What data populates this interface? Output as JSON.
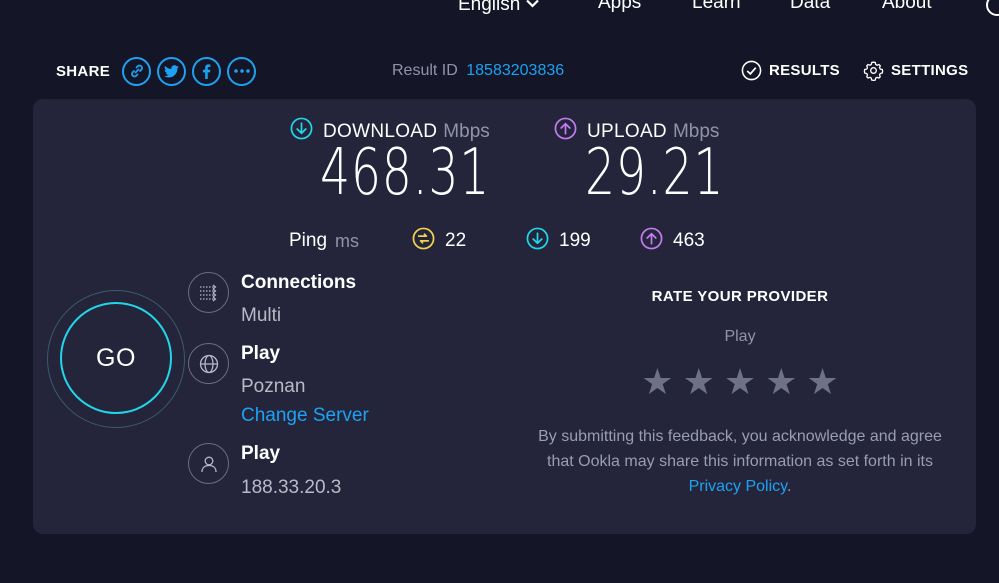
{
  "nav": {
    "language": "English",
    "apps": "Apps",
    "learn": "Learn",
    "data": "Data",
    "about": "About"
  },
  "share": {
    "label": "SHARE"
  },
  "result": {
    "label": "Result ID",
    "id": "18583203836"
  },
  "links": {
    "results": "RESULTS",
    "settings": "SETTINGS"
  },
  "download": {
    "title": "DOWNLOAD",
    "unit": "Mbps",
    "value": "468.31"
  },
  "upload": {
    "title": "UPLOAD",
    "unit": "Mbps",
    "value": "29.21"
  },
  "ping": {
    "label": "Ping",
    "unit": "ms",
    "idle": "22",
    "down": "199",
    "up": "463"
  },
  "go": {
    "label": "GO"
  },
  "connections": {
    "title": "Connections",
    "value": "Multi"
  },
  "server": {
    "name": "Play",
    "location": "Poznan",
    "change": "Change Server"
  },
  "isp": {
    "name": "Play",
    "ip": "188.33.20.3"
  },
  "rate": {
    "title": "RATE YOUR PROVIDER",
    "provider": "Play",
    "stars": 5,
    "disclaimer": "By submitting this feedback, you acknowledge and agree that Ookla may share this information as set forth in its",
    "privacy": "Privacy Policy",
    "end": "."
  },
  "colors": {
    "accent": "#1da1f2",
    "download": "#21d6e8",
    "upload": "#c37cf0",
    "idle_ping": "#f4d44c",
    "card": "#24253b",
    "background": "#141526"
  }
}
